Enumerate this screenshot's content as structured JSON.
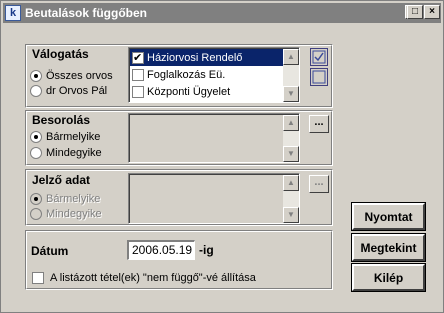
{
  "window": {
    "title": "Beutalások függőben",
    "icon": "app-logo-icon",
    "minimize_glyph": "_",
    "maximize_glyph": "□",
    "close_glyph": "×"
  },
  "selection": {
    "title": "Válogatás",
    "radios": [
      {
        "label": "Összes orvos",
        "checked": true
      },
      {
        "label": "dr Orvos Pál",
        "checked": false
      }
    ],
    "list_items": [
      {
        "label": "Háziorvosi Rendelő",
        "checked": true,
        "selected": true
      },
      {
        "label": "Foglalkozás Eü.",
        "checked": false,
        "selected": false
      },
      {
        "label": "Központi Ügyelet",
        "checked": false,
        "selected": false
      }
    ],
    "select_all_icon": "checkmark-icon",
    "deselect_all_icon": "empty-square-icon"
  },
  "classification": {
    "title": "Besorolás",
    "radios": [
      {
        "label": "Bármelyike",
        "checked": true
      },
      {
        "label": "Mindegyike",
        "checked": false
      }
    ],
    "browse_label": "..."
  },
  "indicator": {
    "title": "Jelző adat",
    "radios": [
      {
        "label": "Bármelyike",
        "checked": true
      },
      {
        "label": "Mindegyike",
        "checked": false
      }
    ],
    "browse_label": "..."
  },
  "date": {
    "label": "Dátum",
    "value": "2006.05.19",
    "suffix": "-ig"
  },
  "option": {
    "checkbox_label": "A listázott tétel(ek) \"nem függő\"-vé állítása",
    "checked": false
  },
  "actions": {
    "print": "Nyomtat",
    "view": "Megtekint",
    "exit": "Kilép"
  },
  "scroll": {
    "up_glyph": "▲",
    "down_glyph": "▼"
  }
}
